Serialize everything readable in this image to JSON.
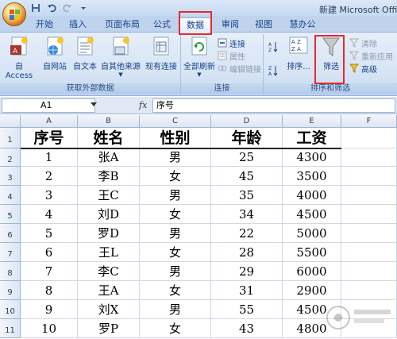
{
  "titlebar": {
    "title": "新建 Microsoft Office",
    "qat_icons": [
      "save-icon",
      "undo-icon",
      "redo-icon"
    ]
  },
  "tabs": [
    {
      "label": "开始"
    },
    {
      "label": "插入"
    },
    {
      "label": "页面布局"
    },
    {
      "label": "公式"
    },
    {
      "label": "数据",
      "active": true
    },
    {
      "label": "审阅"
    },
    {
      "label": "视图"
    },
    {
      "label": "慧办公"
    }
  ],
  "ribbon": {
    "external": {
      "label": "获取外部数据",
      "buttons": [
        "自 Access",
        "自网站",
        "自文本",
        "自其他来源",
        "现有连接"
      ]
    },
    "connections": {
      "label": "连接",
      "refresh_all": "全部刷新",
      "items": [
        "连接",
        "属性",
        "编辑链接"
      ]
    },
    "sort_filter": {
      "label": "排序和筛选",
      "sort": "排序...",
      "filter": "筛选",
      "clear": "清除",
      "reapply": "重新应用",
      "advanced": "高级"
    }
  },
  "formula_bar": {
    "name_box": "A1",
    "fx": "fx",
    "formula": "序号"
  },
  "sheet": {
    "columns": [
      "A",
      "B",
      "C",
      "D",
      "E",
      "F"
    ],
    "row_numbers": [
      "1",
      "2",
      "3",
      "4",
      "5",
      "6",
      "7",
      "8",
      "9",
      "10",
      "11"
    ],
    "headers": [
      "序号",
      "姓名",
      "性别",
      "年龄",
      "工资"
    ],
    "rows": [
      [
        "1",
        "张A",
        "男",
        "25",
        "4300"
      ],
      [
        "2",
        "李B",
        "女",
        "45",
        "3500"
      ],
      [
        "3",
        "王C",
        "男",
        "35",
        "4000"
      ],
      [
        "4",
        "刘D",
        "女",
        "34",
        "4500"
      ],
      [
        "5",
        "罗D",
        "男",
        "22",
        "5000"
      ],
      [
        "6",
        "王L",
        "女",
        "28",
        "5500"
      ],
      [
        "7",
        "李C",
        "男",
        "29",
        "6000"
      ],
      [
        "8",
        "王A",
        "女",
        "31",
        "2900"
      ],
      [
        "9",
        "刘X",
        "男",
        "55",
        "4500"
      ],
      [
        "10",
        "罗P",
        "女",
        "43",
        "4800"
      ]
    ]
  },
  "colors": {
    "highlight": "#e8282d",
    "ribbon_text": "#15428b"
  }
}
